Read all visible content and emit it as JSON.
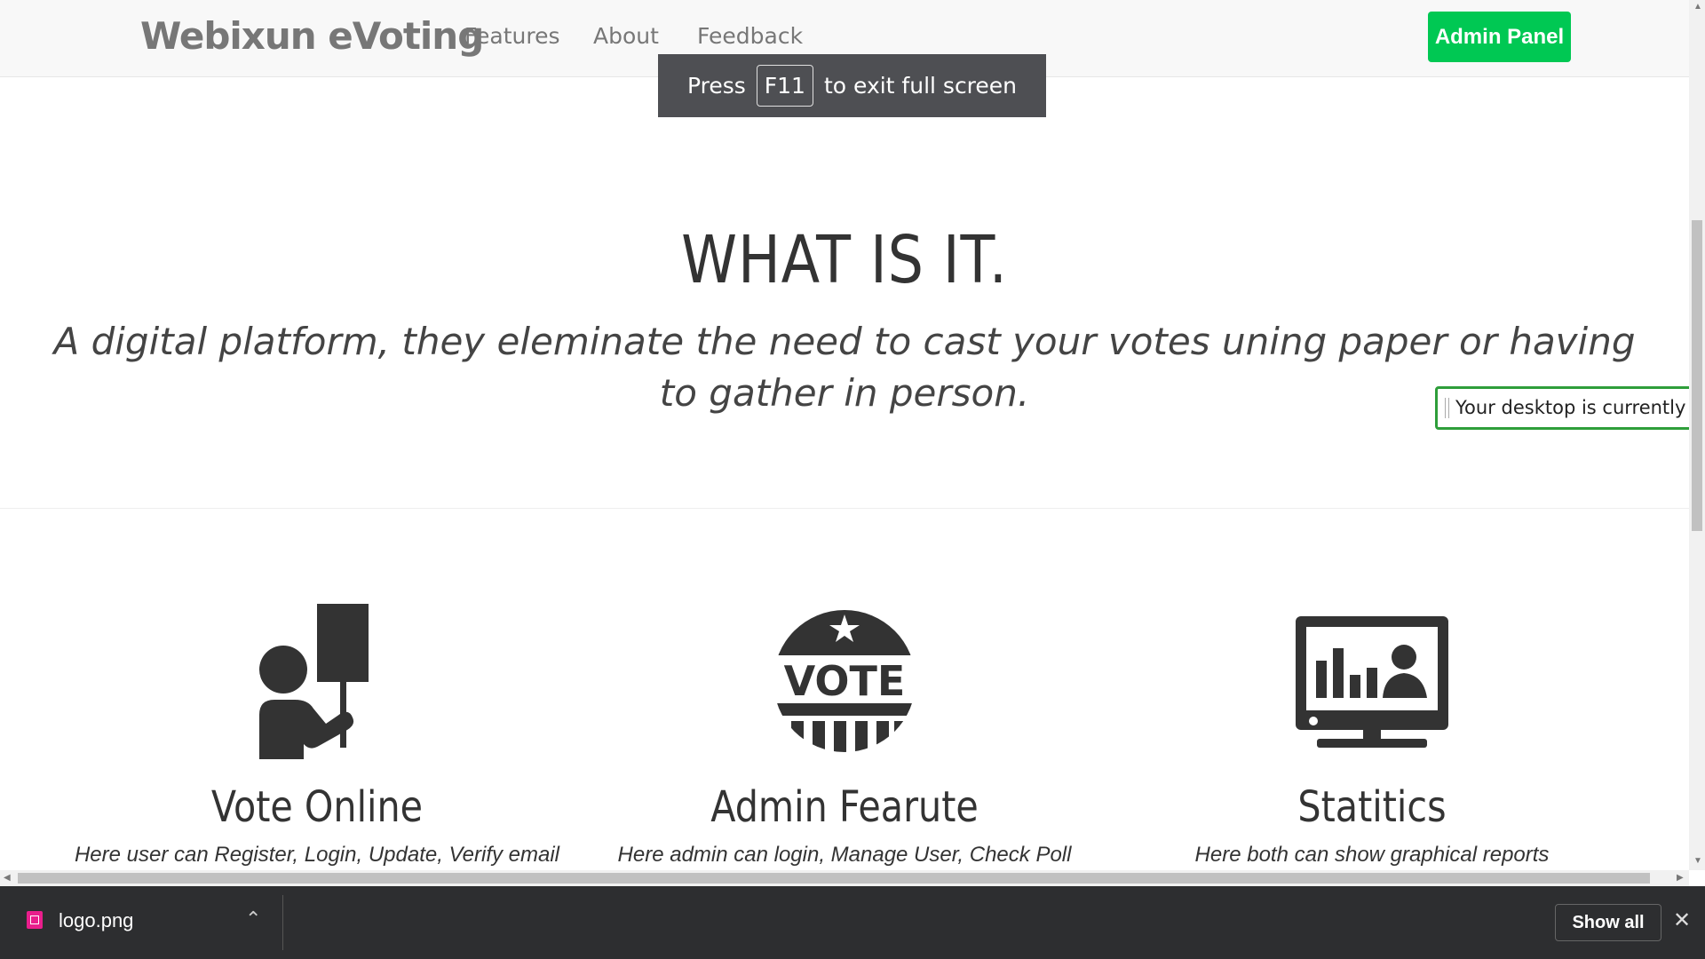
{
  "navbar": {
    "brand": "Webixun eVoting",
    "links": [
      "Features",
      "About",
      "Feedback"
    ],
    "admin_button": "Admin Panel",
    "accent_color": "#00c853"
  },
  "fullscreen_toast": {
    "prefix": "Press",
    "key": "F11",
    "suffix": "to exit full screen"
  },
  "hero": {
    "title": "WHAT IS IT.",
    "subtitle": "A digital platform, they eleminate the need to cast your votes uning paper or having to gather in person."
  },
  "share_notice": "Your desktop is currently shared",
  "features": [
    {
      "icon": "protester-sign-icon",
      "title": "Vote Online",
      "desc": "Here user can Register, Login, Update, Verify email"
    },
    {
      "icon": "vote-badge-icon",
      "title": "Admin Fearute",
      "desc": "Here admin can login, Manage User, Check Poll"
    },
    {
      "icon": "monitor-stats-icon",
      "title": "Statitics",
      "desc": "Here both can show graphical reports"
    }
  ],
  "download_bar": {
    "file_name": "logo.png",
    "file_icon": "image-file-icon",
    "show_all": "Show all",
    "close_icon": "close-icon"
  }
}
